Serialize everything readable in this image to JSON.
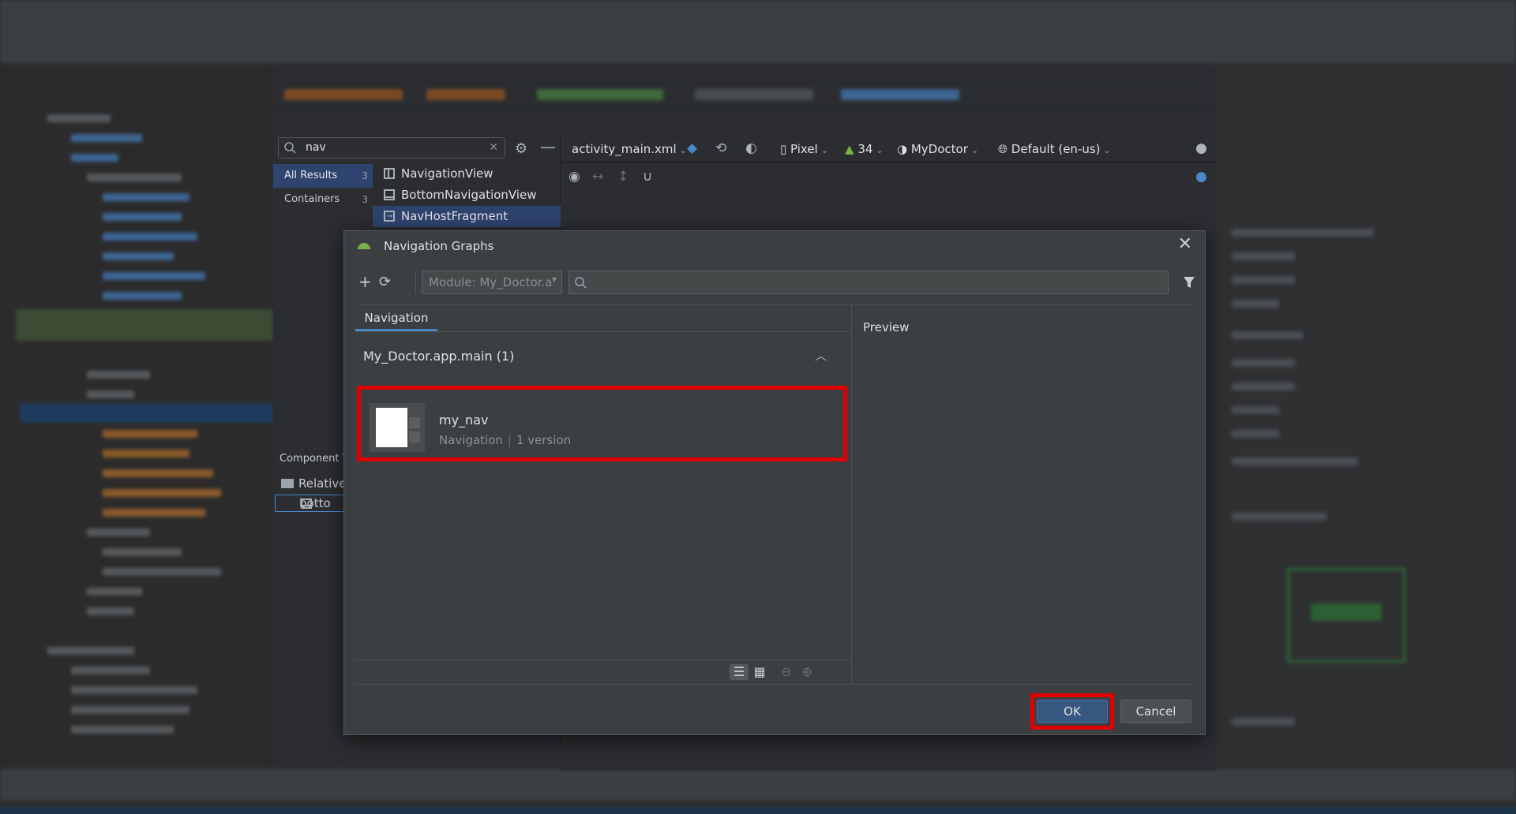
{
  "palette": {
    "search_query": "nav",
    "categories": [
      {
        "label": "All Results",
        "count": "3"
      },
      {
        "label": "Containers",
        "count": "3"
      }
    ],
    "items": [
      {
        "label": "NavigationView"
      },
      {
        "label": "BottomNavigationView"
      },
      {
        "label": "NavHostFragment"
      }
    ]
  },
  "component_tree": {
    "title": "Component T",
    "rows": [
      "Relative",
      "botto"
    ]
  },
  "design_toolbar": {
    "file": "activity_main.xml",
    "device": "Pixel",
    "api": "34",
    "theme": "MyDoctor",
    "locale": "Default (en-us)"
  },
  "dialog": {
    "title": "Navigation Graphs",
    "module_placeholder": "Module: My_Doctor.a",
    "search_placeholder": "",
    "tab_label": "Navigation",
    "group_header": "My_Doctor.app.main (1)",
    "resource": {
      "name": "my_nav",
      "type": "Navigation",
      "versions": "1 version"
    },
    "preview_label": "Preview",
    "ok_label": "OK",
    "cancel_label": "Cancel"
  },
  "colors": {
    "highlight": "#e00000",
    "accent": "#4a88c7",
    "dialog_bg": "#3c3f41"
  }
}
